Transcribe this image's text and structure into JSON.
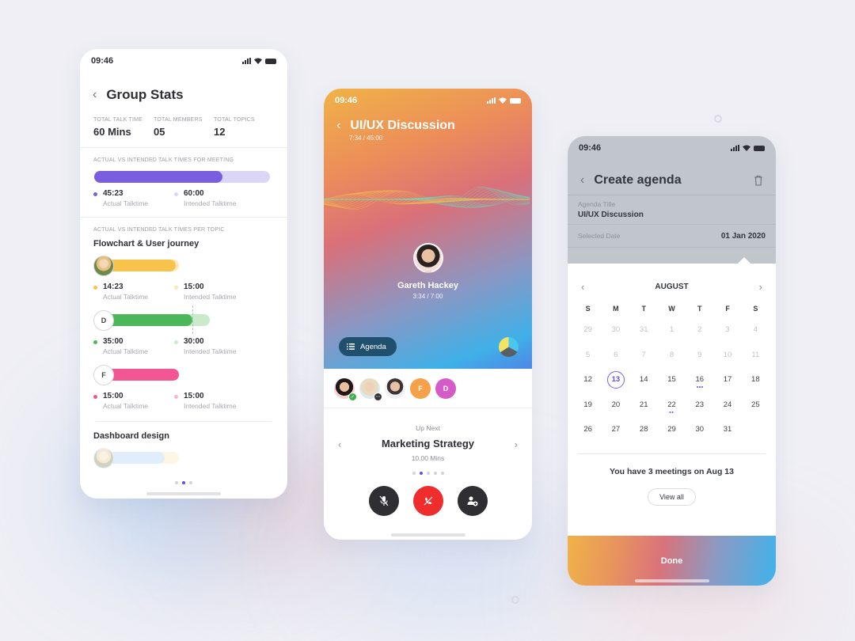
{
  "status_time": "09:46",
  "colors": {
    "accent": "#6a4fd6",
    "meeting_actual": "#7b5ddf",
    "meeting_intended": "#dcd6f6",
    "yellow_actual": "#f7c34b",
    "yellow_intended": "#fde7b4",
    "green_actual": "#4cb75a",
    "green_intended": "#c9ebcc",
    "pink_actual": "#f25793",
    "pink_intended": "#f9b6cf",
    "end_call": "#ef2d2d",
    "dark_button": "#2f2f33"
  },
  "group_stats": {
    "title": "Group Stats",
    "stats": [
      {
        "label": "TOTAL TALK TIME",
        "value": "60 Mins"
      },
      {
        "label": "TOTAL MEMBERS",
        "value": "05"
      },
      {
        "label": "TOTAL TOPICS",
        "value": "12"
      }
    ],
    "meeting_section_label": "ACTUAL VS INTENDED TALK TIMES FOR MEETING",
    "meeting": {
      "actual": "45:23",
      "actual_label": "Actual Talktime",
      "intended": "60:00",
      "intended_label": "Intended Talktime",
      "actual_fraction": 0.73
    },
    "topic_section_label": "ACTUAL VS INTENDED TALK TIMES PER TOPIC",
    "topic_1_title": "Flowchart & User journey",
    "members": [
      {
        "avatar": "photo",
        "initial": "",
        "actual": "14:23",
        "intended": "15:00",
        "actual_label": "Actual Talktime",
        "intended_label": "Intended Talktime",
        "actual_fraction": 0.96
      },
      {
        "avatar": "initial",
        "initial": "D",
        "actual": "35:00",
        "intended": "30:00",
        "actual_label": "Actual Talktime",
        "intended_label": "Intended Talktime",
        "actual_fraction": 1.17
      },
      {
        "avatar": "initial",
        "initial": "F",
        "actual": "15:00",
        "intended": "15:00",
        "actual_label": "Actual Talktime",
        "intended_label": "Intended Talktime",
        "actual_fraction": 1.0
      }
    ],
    "topic_2_title": "Dashboard design",
    "pager": {
      "count": 3,
      "active": 1
    }
  },
  "call": {
    "title": "UI/UX Discussion",
    "elapsed": "7:34 / 45:00",
    "speaker_name": "Gareth Hackey",
    "speaker_time": "3:34 / 7:00",
    "agenda_label": "Agenda",
    "participants": [
      {
        "type": "photo",
        "badge": "check"
      },
      {
        "type": "photo",
        "badge": "more"
      },
      {
        "type": "photo",
        "badge": ""
      },
      {
        "type": "initial",
        "initial": "F",
        "color": "#f7a04a"
      },
      {
        "type": "initial",
        "initial": "D",
        "color": "#d55bc7"
      }
    ],
    "up_next_label": "Up Next",
    "up_next_title": "Marketing Strategy",
    "up_next_duration": "10.00 Mins",
    "pager": {
      "count": 5,
      "active": 1
    }
  },
  "agenda": {
    "title": "Create agenda",
    "title_field_label": "Agenda Title",
    "title_field_value": "UI/UX Discussion",
    "date_field_label": "Selected Date",
    "date_field_value": "01 Jan 2020",
    "month": "AUGUST",
    "weekdays": [
      "S",
      "M",
      "T",
      "W",
      "T",
      "F",
      "S"
    ],
    "days": [
      {
        "n": "29",
        "muted": true
      },
      {
        "n": "30",
        "muted": true
      },
      {
        "n": "31",
        "muted": true
      },
      {
        "n": "1",
        "muted": true
      },
      {
        "n": "2",
        "muted": true
      },
      {
        "n": "3",
        "muted": true
      },
      {
        "n": "4",
        "muted": true
      },
      {
        "n": "5",
        "muted": true
      },
      {
        "n": "6",
        "muted": true
      },
      {
        "n": "7",
        "muted": true
      },
      {
        "n": "8",
        "muted": true
      },
      {
        "n": "9",
        "muted": true
      },
      {
        "n": "10",
        "muted": true
      },
      {
        "n": "11",
        "muted": true
      },
      {
        "n": "12"
      },
      {
        "n": "13",
        "selected": true
      },
      {
        "n": "14"
      },
      {
        "n": "15"
      },
      {
        "n": "16",
        "events": 3
      },
      {
        "n": "17"
      },
      {
        "n": "18"
      },
      {
        "n": "19"
      },
      {
        "n": "20"
      },
      {
        "n": "21"
      },
      {
        "n": "22",
        "events": 2
      },
      {
        "n": "23"
      },
      {
        "n": "24"
      },
      {
        "n": "25"
      },
      {
        "n": "26"
      },
      {
        "n": "27"
      },
      {
        "n": "28"
      },
      {
        "n": "29"
      },
      {
        "n": "30"
      },
      {
        "n": "31"
      }
    ],
    "meetings_message": "You have 3 meetings on Aug 13",
    "view_all_label": "View all",
    "done_label": "Done"
  }
}
